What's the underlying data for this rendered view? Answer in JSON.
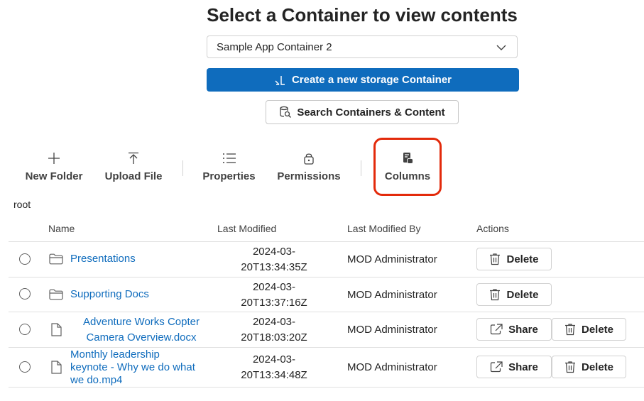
{
  "header": {
    "title": "Select a Container to view contents"
  },
  "container_select": {
    "selected": "Sample App Container 2"
  },
  "buttons": {
    "create": "Create a new storage Container",
    "search": "Search Containers & Content"
  },
  "toolbar": [
    {
      "label": "New Folder",
      "icon": "plus-icon"
    },
    {
      "label": "Upload File",
      "icon": "upload-icon"
    },
    {
      "label": "Properties",
      "icon": "list-icon"
    },
    {
      "label": "Permissions",
      "icon": "lock-icon"
    },
    {
      "label": "Columns",
      "icon": "columns-icon"
    }
  ],
  "breadcrumb": "root",
  "table": {
    "headers": [
      "Name",
      "Last Modified",
      "Last Modified By",
      "Actions"
    ],
    "rows": [
      {
        "type": "folder",
        "name": "Presentations",
        "date_line1": "2024-03-",
        "date_line2": "20T13:34:35Z",
        "by": "MOD Administrator",
        "actions": [
          "Delete"
        ]
      },
      {
        "type": "folder",
        "name": "Supporting Docs",
        "date_line1": "2024-03-",
        "date_line2": "20T13:37:16Z",
        "by": "MOD Administrator",
        "actions": [
          "Delete"
        ]
      },
      {
        "type": "file",
        "name_line1": "Adventure Works Copter",
        "name_line2": "Camera Overview.docx",
        "date_line1": "2024-03-",
        "date_line2": "20T18:03:20Z",
        "by": "MOD Administrator",
        "actions": [
          "Share",
          "Delete"
        ]
      },
      {
        "type": "file",
        "name_line1": "Monthly leadership",
        "name_line2": "keynote - Why we do what",
        "name_line3": "we do.mp4",
        "date_line1": "2024-03-",
        "date_line2": "20T13:34:48Z",
        "by": "MOD Administrator",
        "actions": [
          "Share",
          "Delete"
        ]
      }
    ]
  },
  "colors": {
    "accent": "#0f6cbd",
    "highlight": "#e32a0b"
  }
}
